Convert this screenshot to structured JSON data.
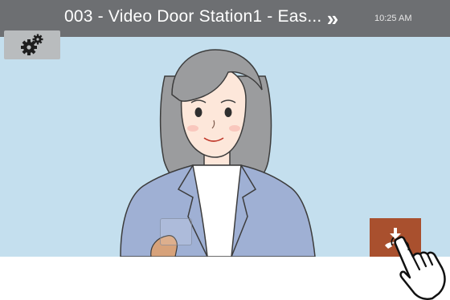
{
  "header": {
    "title": "003 - Video Door Station1 - Eas...",
    "next_label": "»",
    "clock": "10:25 AM"
  },
  "icons": {
    "settings": "gears-icon",
    "next": "double-chevron-right-icon",
    "end_call": "hang-up-icon",
    "pointer": "pointing-hand-icon"
  },
  "colors": {
    "titlebar": "#6d6f72",
    "video_background": "#c4dfee",
    "end_call_button": "#a9502e",
    "settings_button": "#b9bcbe"
  }
}
